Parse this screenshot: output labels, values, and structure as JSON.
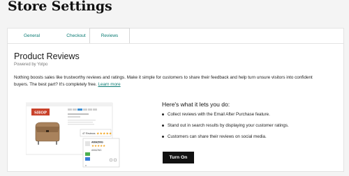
{
  "page": {
    "title": "Store Settings"
  },
  "tabs": [
    {
      "label": "General",
      "active": false
    },
    {
      "label": "Checkout",
      "active": false
    },
    {
      "label": "Reviews",
      "active": true
    }
  ],
  "reviews": {
    "title": "Product Reviews",
    "powered_by": "Powered by Yotpo",
    "description": "Nothing boosts sales like trustworthy reviews and ratings. Make it simple for customers to share their feedback and help turn unsure visitors into confident buyers. The best part? It's completely free.",
    "learn_more": "Learn more",
    "heres_what": "Here's what it lets you do:",
    "features": [
      "Collect reviews with the Email After Purchase feature.",
      "Stand out in search results by displaying your customer ratings.",
      "Customers can share their reviews on social media."
    ],
    "turn_on": "Turn On"
  },
  "illustration": {
    "store_logo": "SHOP",
    "badge_text": "47 Reviews",
    "review_title": "AMAZING",
    "review_body": "AMAZING",
    "colors": {
      "brand_red": "#c9412a",
      "star_gold": "#f2a31a",
      "bag": "#a9825c",
      "accent_teal": "#0a7b73"
    }
  }
}
